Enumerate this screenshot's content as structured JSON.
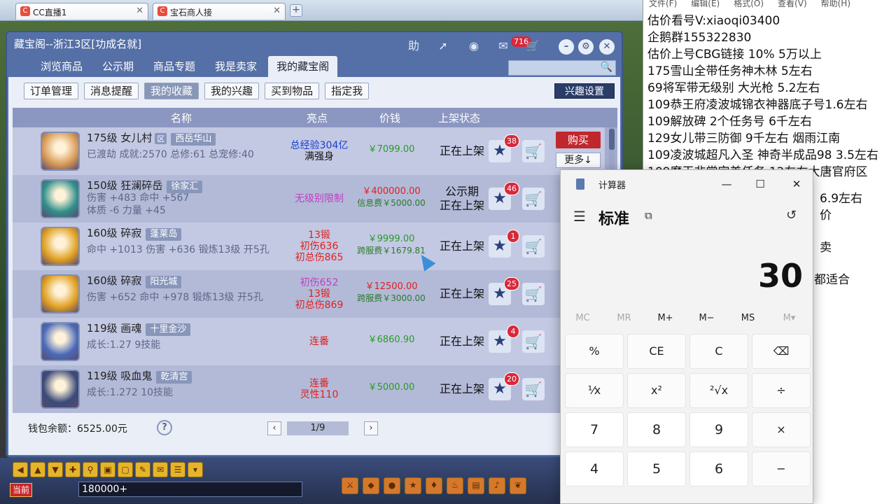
{
  "browser_tabs": [
    {
      "label": "CC直播1"
    },
    {
      "label": "宝石商人接"
    }
  ],
  "notepad": {
    "menu": [
      "文件(F)",
      "编辑(E)",
      "格式(O)",
      "查看(V)",
      "帮助(H)"
    ],
    "lines": [
      "估价看号V:xiaoqi03400",
      "企鹅群155322830",
      "估价上号CBG链接 10% 5万以上",
      "175雪山全带任务神木林 5左右",
      "69将军带无级别 大光枪 5.2左右",
      "109恭王府凌波城锦衣神器底子号1.6左右",
      "109解放碑 2个任务号 6千左右",
      "129女儿带三防御 9千左右 烟雨江南",
      "109凌波城超凡入圣 神奇半成品98 3.5左右",
      "109魔王非常完美任务 12左右大唐官府区",
      "6.9左右",
      "价",
      "卖",
      "都适合"
    ]
  },
  "window": {
    "title": "藏宝阁--浙江3区[功成名就]",
    "help_label": "助",
    "message_count": "716",
    "nav_tabs": [
      "浏览商品",
      "公示期",
      "商品专题",
      "我是卖家",
      "我的藏宝阁"
    ],
    "sub_tabs": [
      "订单管理",
      "消息提醒",
      "我的收藏",
      "我的兴趣",
      "买到物品",
      "指定我"
    ],
    "interest_settings": "兴趣设置",
    "columns": {
      "name": "名称",
      "highlight": "亮点",
      "price": "价钱",
      "status": "上架状态"
    },
    "buy_label": "购买",
    "more_label": "更多↓",
    "wallet": "钱包余额：6525.00元",
    "page": "1/9"
  },
  "items": [
    {
      "name": "175级 女儿村",
      "badge": "区",
      "server": "西岳华山",
      "desc": [
        "已渡劫 成就:2570 总修:61 总宠修:40"
      ],
      "highlight": [
        "总经验304亿",
        "满强身"
      ],
      "highlight_colors": [
        "#1a3fd0",
        "#111111"
      ],
      "price": "￥7099.00",
      "fee": "",
      "status": [
        "正在上架"
      ],
      "stars": "38",
      "avatar_color": "#d89a56"
    },
    {
      "name": "150级 狂澜碎岳",
      "badge": "",
      "server": "徐家汇",
      "desc": [
        "伤害 +483 命中 +567",
        "体质 -6 力量 +45"
      ],
      "highlight": [
        "无级别限制"
      ],
      "highlight_colors": [
        "#c040c0"
      ],
      "price": "￥400000.00",
      "fee": "信息费￥5000.00",
      "status": [
        "公示期",
        "正在上架"
      ],
      "stars": "46",
      "avatar_color": "#2f8f8a"
    },
    {
      "name": "160级 碎寂",
      "badge": "",
      "server": "蓬莱岛",
      "desc": [
        "命中 +1013 伤害 +636 锻炼13级 开5孔"
      ],
      "highlight": [
        "13锻",
        "初伤636",
        "初总伤865"
      ],
      "highlight_colors": [
        "#e02020",
        "#e02020",
        "#e02020"
      ],
      "price": "￥9999.00",
      "fee": "跨服费￥1679.81",
      "status": [
        "正在上架"
      ],
      "stars": "1",
      "avatar_color": "#e0a020"
    },
    {
      "name": "160级 碎寂",
      "badge": "",
      "server": "阳光城",
      "desc": [
        "伤害 +652 命中 +978 锻炼13级 开5孔"
      ],
      "highlight": [
        "初伤652",
        "13锻",
        "初总伤869"
      ],
      "highlight_colors": [
        "#c040c0",
        "#e02020",
        "#e02020"
      ],
      "price": "￥12500.00",
      "fee": "跨服费￥3000.00",
      "status": [
        "正在上架"
      ],
      "stars": "25",
      "avatar_color": "#e0a020"
    },
    {
      "name": "119级 画魂",
      "badge": "",
      "server": "十里金沙",
      "desc": [
        "成长:1.27 9技能"
      ],
      "highlight": [
        "连番"
      ],
      "highlight_colors": [
        "#e02020"
      ],
      "price": "￥6860.90",
      "fee": "",
      "status": [
        "正在上架"
      ],
      "stars": "4",
      "avatar_color": "#4a6ab8"
    },
    {
      "name": "119级 吸血鬼",
      "badge": "",
      "server": "乾清宫",
      "desc": [
        "成长:1.272 10技能"
      ],
      "highlight": [
        "连番",
        "灵性110"
      ],
      "highlight_colors": [
        "#e02020",
        "#e02020"
      ],
      "price": "￥5000.00",
      "fee": "",
      "status": [
        "正在上架"
      ],
      "stars": "20",
      "avatar_color": "#3a4a78"
    }
  ],
  "game_bar": {
    "channel": "当前",
    "chat_value": "180000+"
  },
  "calculator": {
    "title": "计算器",
    "mode": "标准",
    "display": "30",
    "memory": [
      "MC",
      "MR",
      "M+",
      "M−",
      "MS",
      "M▾"
    ],
    "keys": [
      [
        "%",
        "CE",
        "C",
        "⌫"
      ],
      [
        "¹⁄x",
        "x²",
        "²√x",
        "÷"
      ],
      [
        "7",
        "8",
        "9",
        "×"
      ],
      [
        "4",
        "5",
        "6",
        "−"
      ]
    ]
  }
}
